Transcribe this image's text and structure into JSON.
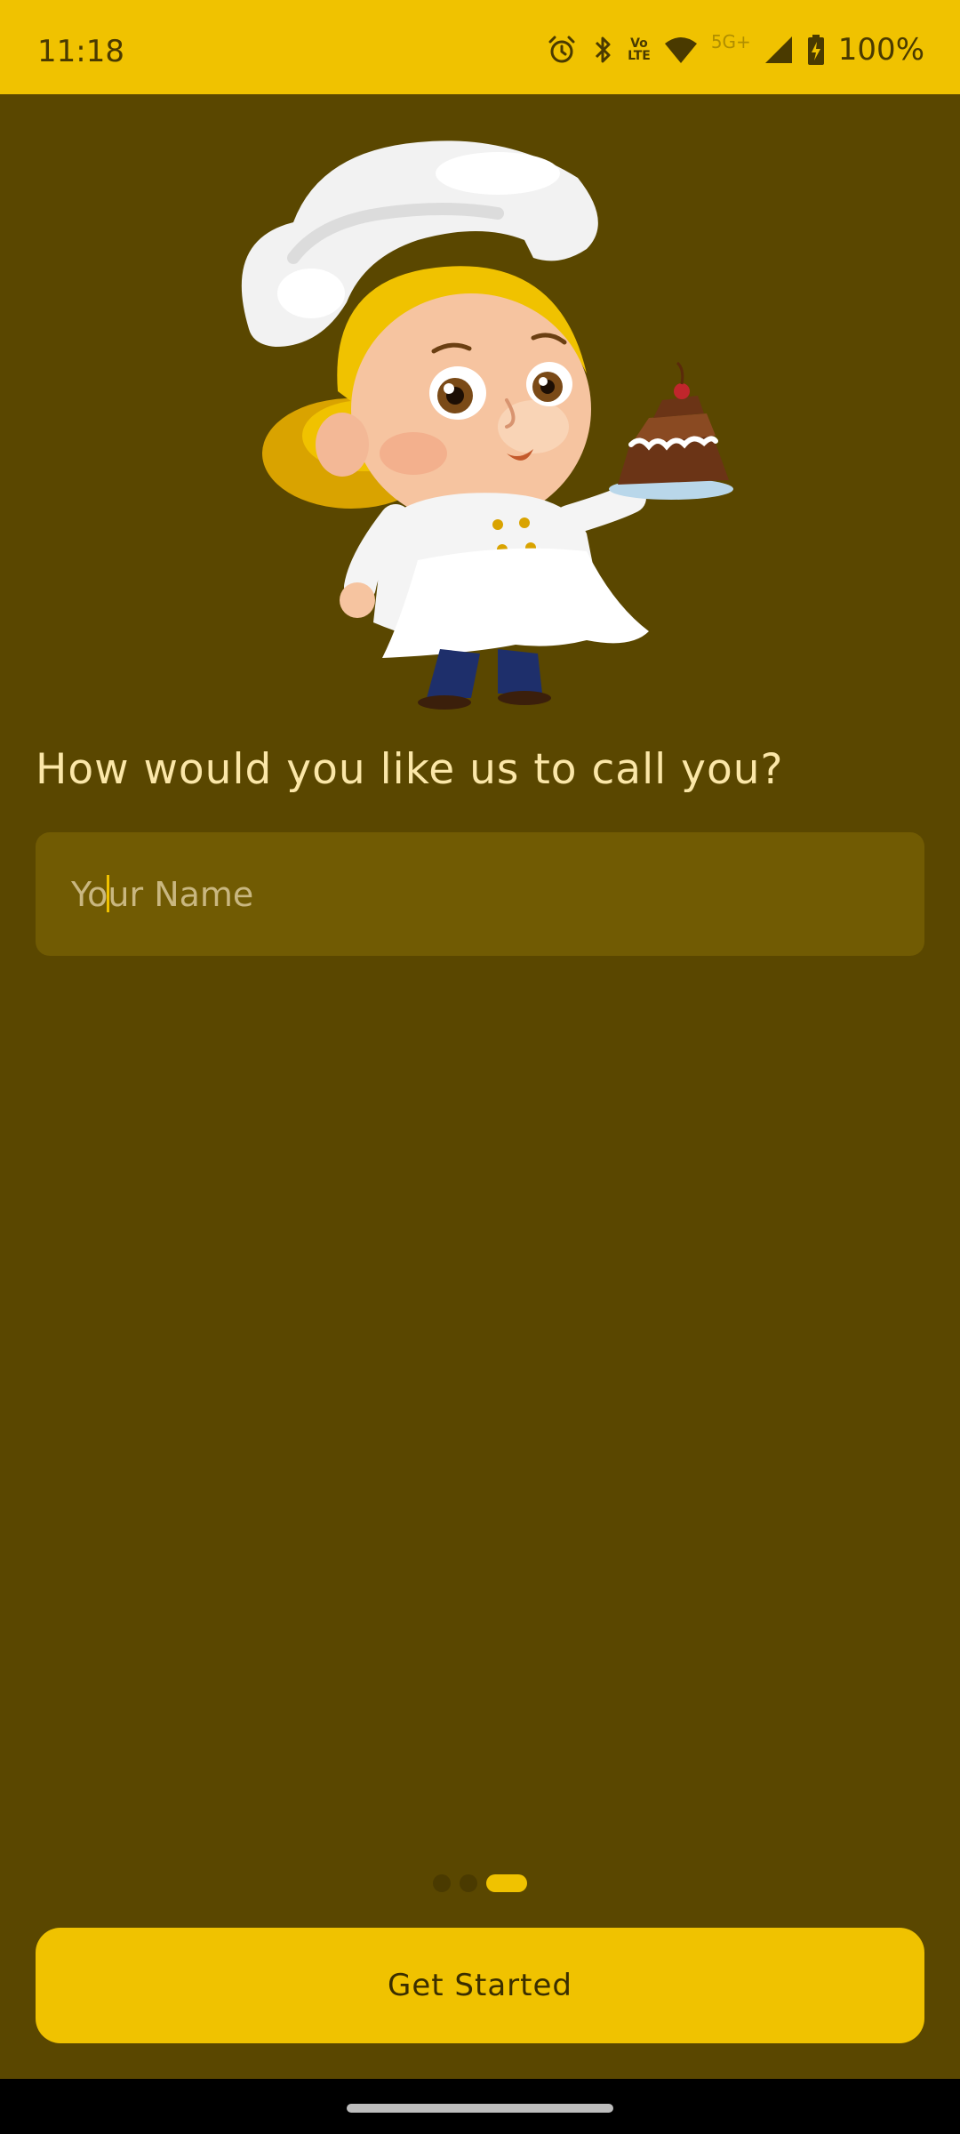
{
  "status_bar": {
    "time": "11:18",
    "volte_top": "Vo",
    "volte_bottom": "LTE",
    "network_label": "5G+",
    "battery_percent": "100%",
    "icons": [
      "alarm-icon",
      "bluetooth-icon",
      "volte-icon",
      "wifi-icon",
      "signal-icon",
      "battery-charging-icon"
    ]
  },
  "onboarding": {
    "illustration": "chef-girl-with-cake-illustration",
    "question": "How would you like us to call you?",
    "name_field": {
      "value": "",
      "placeholder": "Your Name"
    },
    "page_indicator": {
      "total": 3,
      "current": 3
    },
    "primary_button_label": "Get Started"
  },
  "colors": {
    "background": "#5a4700",
    "accent": "#f0c200",
    "input_background": "#715b03",
    "question_text": "#fbe7a8"
  }
}
